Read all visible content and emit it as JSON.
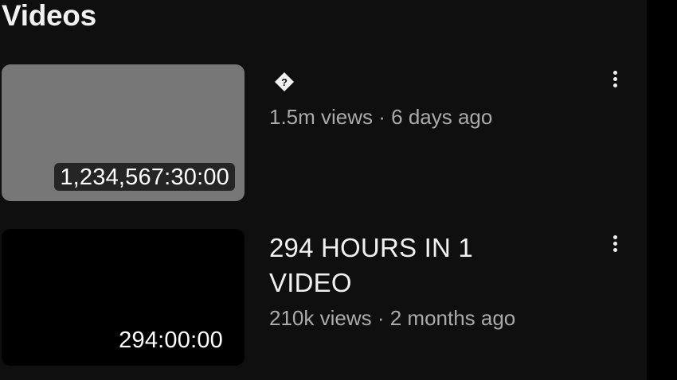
{
  "section": {
    "title": "Videos"
  },
  "videos": [
    {
      "title_icon": "unknown-character-icon",
      "title_icon_glyph": "?",
      "duration": "1,234,567:30:00",
      "stats": "1.5m views · 6 days ago",
      "thumbnail_color": "#777777"
    },
    {
      "title": "294 HOURS IN 1 VIDEO",
      "duration": "294:00:00",
      "stats": "210k views · 2 months ago",
      "thumbnail_color": "#000000"
    }
  ],
  "menu_icon": "more-vertical-icon"
}
